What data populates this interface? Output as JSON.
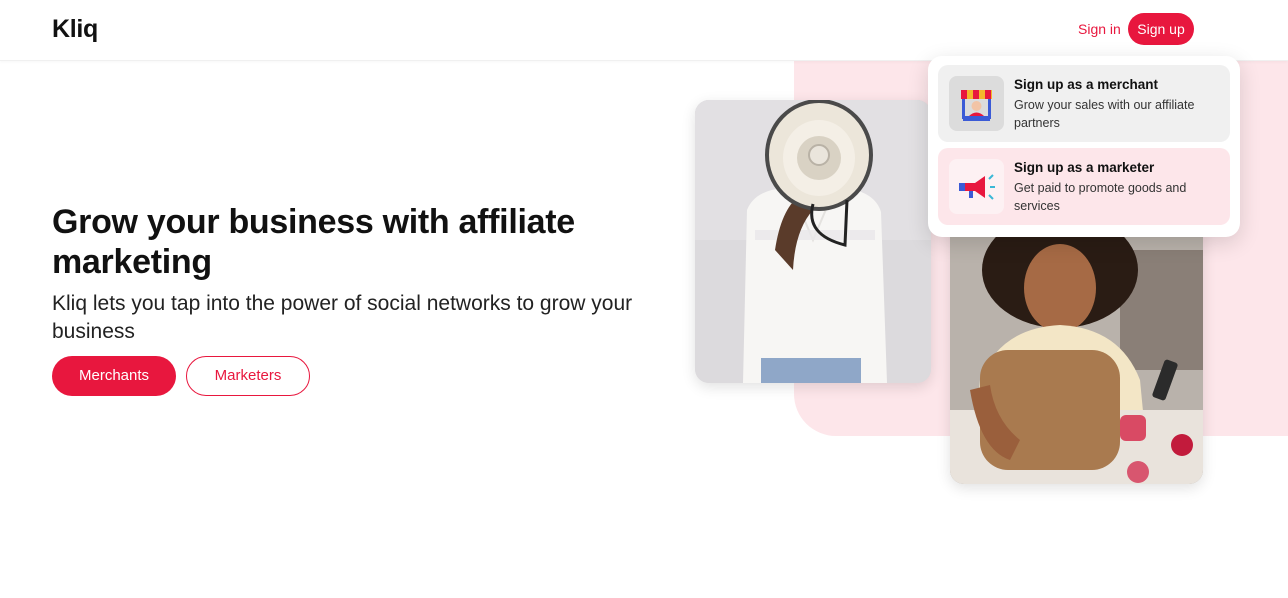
{
  "header": {
    "logo": "Kliq",
    "signin_label": "Sign in",
    "signup_label": "Sign up"
  },
  "hero": {
    "title": "Grow your business with affiliate marketing",
    "subtitle": "Kliq lets you tap into the power of social networks to grow your business",
    "merchants_label": "Merchants",
    "marketers_label": "Marketers"
  },
  "signup_menu": {
    "items": [
      {
        "title": "Sign up as a merchant",
        "description": "Grow your sales with our affiliate partners",
        "icon": "storefront-icon"
      },
      {
        "title": "Sign up as a marketer",
        "description": "Get paid to promote goods and services",
        "icon": "megaphone-icon"
      }
    ]
  },
  "images": {
    "photo_1": "person-with-megaphone",
    "photo_2": "woman-with-makeup-and-phone"
  },
  "colors": {
    "brand": "#e8173e",
    "pink_background": "#fde6ea",
    "menu_item_grey": "#f0f0f0"
  }
}
